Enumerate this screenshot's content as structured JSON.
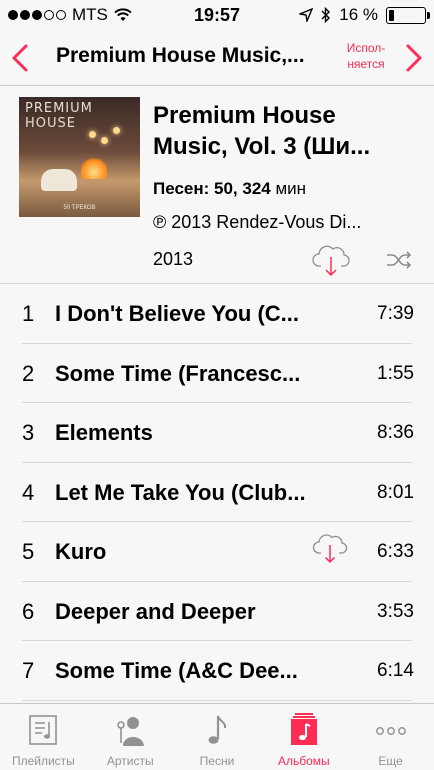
{
  "status": {
    "carrier": "MTS",
    "time": "19:57",
    "battery": "16 %",
    "battery_level": 0.16,
    "signal_bars": 3
  },
  "nav": {
    "title": "Premium House Music,...",
    "now_playing_line1": "Испол-",
    "now_playing_line2": "няется"
  },
  "album": {
    "cover_text_line1": "PREMIUM",
    "cover_text_line2": "HOUSE",
    "cover_strip": "50 ТРЕКОВ",
    "title_line1": "Premium House",
    "title_line2": "Music, Vol. 3 (Ши...",
    "count": "Песен: 50, 324",
    "count_unit": "мин",
    "copyright": "℗ 2013 Rendez-Vous Di...",
    "year": "2013"
  },
  "tracks": [
    {
      "number": "1",
      "title": "I Don't Believe You (C...",
      "duration": "7:39",
      "cloud": false
    },
    {
      "number": "2",
      "title": "Some Time (Francesc...",
      "duration": "1:55",
      "cloud": false
    },
    {
      "number": "3",
      "title": "Elements",
      "duration": "8:36",
      "cloud": false
    },
    {
      "number": "4",
      "title": "Let Me Take You (Club...",
      "duration": "8:01",
      "cloud": false
    },
    {
      "number": "5",
      "title": "Kuro",
      "duration": "6:33",
      "cloud": true
    },
    {
      "number": "6",
      "title": "Deeper and Deeper",
      "duration": "3:53",
      "cloud": false
    },
    {
      "number": "7",
      "title": "Some Time (A&C Dee...",
      "duration": "6:14",
      "cloud": false
    }
  ],
  "tabs": [
    {
      "label": "Плейлисты",
      "icon": "playlist-icon",
      "active": false
    },
    {
      "label": "Артисты",
      "icon": "artist-icon",
      "active": false
    },
    {
      "label": "Песни",
      "icon": "note-icon",
      "active": false
    },
    {
      "label": "Альбомы",
      "icon": "album-icon",
      "active": true
    },
    {
      "label": "Еще",
      "icon": "more-icon",
      "active": false
    }
  ],
  "colors": {
    "accent": "#ff2d55",
    "inactive": "#929292"
  }
}
